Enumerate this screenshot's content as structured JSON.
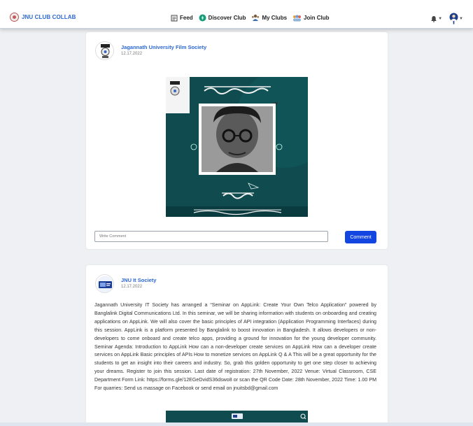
{
  "navbar": {
    "brand": "JNU CLUB COLLAB",
    "items": [
      {
        "label": "Feed",
        "icon": "feed-icon"
      },
      {
        "label": "Discover Club",
        "icon": "discover-icon"
      },
      {
        "label": "My Clubs",
        "icon": "my-clubs-icon"
      },
      {
        "label": "Join Club",
        "icon": "join-club-icon"
      }
    ],
    "notifications_icon": "bell-icon",
    "user_icon": "user-avatar-icon"
  },
  "posts": [
    {
      "author": "Jagannath University Film Society",
      "date": "12.17.2022",
      "image": "poster-image",
      "comment_placeholder": "Write Comment",
      "comment_button": "Comment"
    },
    {
      "author": "JNU It Society",
      "date": "12.17.2022",
      "text": "Jagannath University IT Society has arranged a “Seminar on AppLink: Create Your Own Telco Application” powered by Banglalink Digital Communications Ltd. In this seminar, we will be sharing information with students on onboarding and creating applications on AppLink. We will also cover the basic principles of API integration (Application Programming Interfaces) during this session. AppLink is a platform presented by Banglalink to boost innovation in Bangladesh. It allows developers or non-developers to come onboard and create telco apps, providing a ground for innovation for the young developer community. Seminar Agenda: Introduction to AppLink How can a non-developer create services on AppLink How can a developer create services on AppLink Basic principles of APIs How to monetize services on AppLink Q & A This will be a great opportunity for the students to get an insight into their careers and industry. So, grab this golden opportunity to get one step closer to achieving your dreams. Register to join this session. Last date of registration: 27th November, 2022 Venue: Virtual Classroom, CSE Department Form Link: https://forms.gle/12EGeDvidS36dswo8 or scan the QR Code Date: 28th November, 2022 Time: 1.00 PM For quarries: Send us massage on Facebook or send email on jnuitsbd@gmail.com"
    }
  ],
  "colors": {
    "brand": "#2b68d6",
    "primary_button": "#1346e0",
    "poster_bg": "#0f4b4f"
  }
}
